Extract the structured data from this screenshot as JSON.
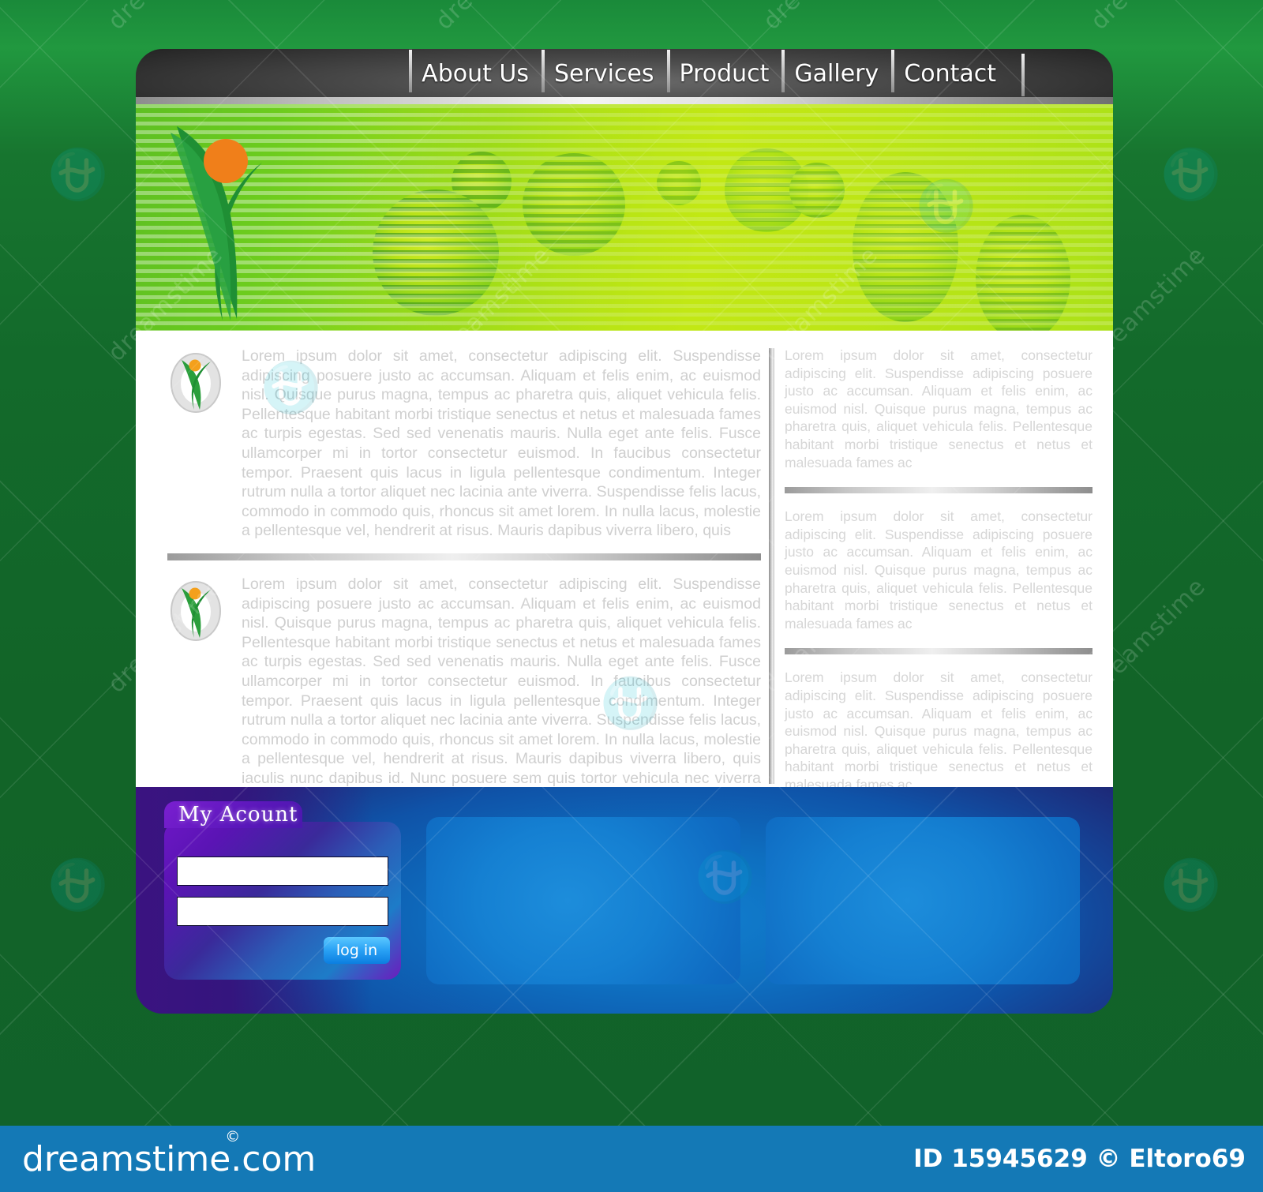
{
  "nav": {
    "items": [
      {
        "label": "About Us",
        "name": "nav-about-us"
      },
      {
        "label": "Services",
        "name": "nav-services"
      },
      {
        "label": "Product",
        "name": "nav-product"
      },
      {
        "label": "Gallery",
        "name": "nav-gallery"
      },
      {
        "label": "Contact",
        "name": "nav-contact"
      }
    ]
  },
  "banner": {
    "logo_name": "runner-logo-icon"
  },
  "main": {
    "blocks": [
      {
        "icon": "runner-badge-icon",
        "text": "Lorem ipsum dolor sit amet, consectetur adipiscing elit. Suspendisse adipiscing posuere justo ac accumsan. Aliquam et felis enim, ac euismod nisl. Quisque purus magna, tempus ac pharetra quis, aliquet vehicula felis. Pellentesque habitant morbi tristique senectus et netus et malesuada fames ac turpis egestas. Sed sed venenatis mauris. Nulla eget ante felis. Fusce ullamcorper mi in tortor consectetur euismod. In faucibus consectetur tempor. Praesent quis lacus in ligula pellentesque condimentum. Integer rutrum nulla a tortor aliquet nec lacinia ante viverra. Suspendisse felis lacus, commodo in commodo quis, rhoncus sit amet lorem. In nulla lacus, molestie a pellentesque vel, hendrerit at risus. Mauris dapibus viverra libero, quis"
      },
      {
        "icon": "runner-badge-icon",
        "text": "Lorem ipsum dolor sit amet, consectetur adipiscing elit. Suspendisse adipiscing posuere justo ac accumsan. Aliquam et felis enim, ac euismod nisl. Quisque purus magna, tempus ac pharetra quis, aliquet vehicula felis. Pellentesque habitant morbi tristique senectus et netus et malesuada fames ac turpis egestas. Sed sed venenatis mauris. Nulla eget ante felis. Fusce ullamcorper mi in tortor consectetur euismod. In faucibus consectetur tempor. Praesent quis lacus in ligula pellentesque condimentum. Integer rutrum nulla a tortor aliquet nec lacinia ante viverra. Suspendisse felis lacus, commodo in commodo quis, rhoncus sit amet lorem. In nulla lacus, molestie a pellentesque vel, hendrerit at risus. Mauris dapibus viverra libero, quis iaculis nunc dapibus id. Nunc posuere sem quis tortor vehicula nec viverra sem ullamcorper. Class aptent taciti sociosqu ad litora torquent per conubia nostra, per inceptos himenaeos. Vestibulum porttitor viverra cursus. Mauris"
      }
    ]
  },
  "sidebar": {
    "blocks": [
      {
        "text": "Lorem ipsum dolor sit amet, consectetur adipiscing elit. Suspendisse adipiscing posuere justo ac accumsan. Aliquam et felis enim, ac euismod nisl. Quisque purus magna, tempus ac pharetra quis, aliquet vehicula felis. Pellentesque habitant morbi tristique senectus et netus et malesuada fames ac"
      },
      {
        "text": "Lorem ipsum dolor sit amet, consectetur adipiscing elit. Suspendisse adipiscing posuere justo ac accumsan. Aliquam et felis enim, ac euismod nisl. Quisque purus magna, tempus ac pharetra quis, aliquet vehicula felis. Pellentesque habitant morbi tristique senectus et netus et malesuada fames ac"
      },
      {
        "text": "Lorem ipsum dolor sit amet, consectetur adipiscing elit. Suspendisse adipiscing posuere justo ac accumsan. Aliquam et felis enim, ac euismod nisl. Quisque purus magna, tempus ac pharetra quis, aliquet vehicula felis. Pellentesque habitant morbi tristique senectus et netus et malesuada fames ac"
      },
      {
        "text": "Lorem ipsum dolor sit amet, consectetur adipiscing elit. Suspendisse adipiscing posuere justo ac accumsan. Aliquam et felis enim, ac euismod nisl. Quisque purus magna, tempus ac pharetra quis, aliquet vehicula felis. Pellentesque habitant morbi tristique senectus et netus et malesuada fames ac"
      }
    ]
  },
  "footer": {
    "account": {
      "title": "My  Acount",
      "username_value": "",
      "password_value": "",
      "login_label": "log in"
    },
    "panels": [
      {
        "name": "footer-panel-left"
      },
      {
        "name": "footer-panel-right"
      }
    ]
  },
  "watermark": {
    "brand": "dreamstime",
    "brand_suffix": ".com",
    "registered": "©",
    "id_line": "ID 15945629 © Eltoro69",
    "tile_text": "dreamstime"
  },
  "colors": {
    "background_green": "#126428",
    "banner_green": "#6ccc1e",
    "banner_yellow": "#d3ec12",
    "accent_orange": "#f07f1a",
    "footer_blue": "#1180d0",
    "footer_purple": "#3b1380",
    "bar_blue": "#1479b6",
    "login_blue": "#2aa2f5"
  }
}
